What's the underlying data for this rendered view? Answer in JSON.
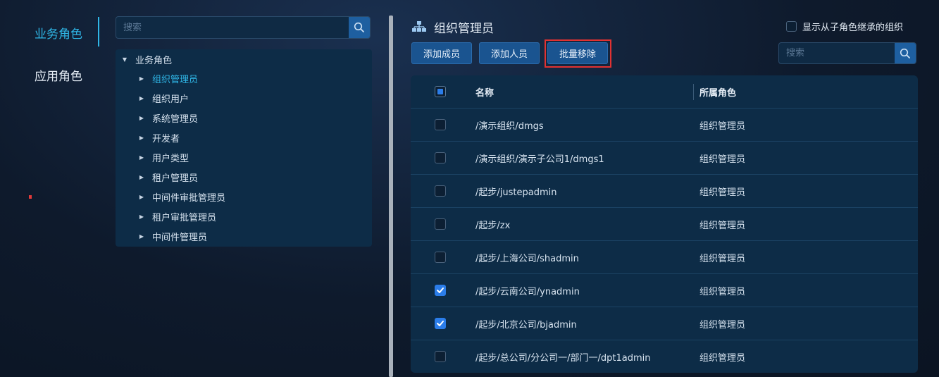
{
  "left_tabs": [
    {
      "label": "业务角色",
      "active": true
    },
    {
      "label": "应用角色",
      "active": false
    }
  ],
  "tree": {
    "search_placeholder": "搜索",
    "root": {
      "label": "业务角色",
      "expanded": true
    },
    "items": [
      {
        "label": "组织管理员",
        "selected": true
      },
      {
        "label": "组织用户",
        "selected": false
      },
      {
        "label": "系统管理员",
        "selected": false
      },
      {
        "label": "开发者",
        "selected": false
      },
      {
        "label": "用户类型",
        "selected": false
      },
      {
        "label": "租户管理员",
        "selected": false
      },
      {
        "label": "中间件审批管理员",
        "selected": false
      },
      {
        "label": "租户审批管理员",
        "selected": false
      },
      {
        "label": "中间件管理员",
        "selected": false
      }
    ]
  },
  "panel": {
    "title": "组织管理员",
    "inherit_option_label": "显示从子角色继承的组织",
    "inherit_checked": false,
    "buttons": {
      "add_member": "添加成员",
      "add_person": "添加人员",
      "batch_remove": "批量移除"
    },
    "search_placeholder": "搜索"
  },
  "table": {
    "columns": {
      "name": "名称",
      "role": "所属角色"
    },
    "header_partial_selected": true,
    "rows": [
      {
        "name": "/演示组织/dmgs",
        "role": "组织管理员",
        "checked": false
      },
      {
        "name": "/演示组织/演示子公司1/dmgs1",
        "role": "组织管理员",
        "checked": false
      },
      {
        "name": "/起步/justepadmin",
        "role": "组织管理员",
        "checked": false
      },
      {
        "name": "/起步/zx",
        "role": "组织管理员",
        "checked": false
      },
      {
        "name": "/起步/上海公司/shadmin",
        "role": "组织管理员",
        "checked": false
      },
      {
        "name": "/起步/云南公司/ynadmin",
        "role": "组织管理员",
        "checked": true
      },
      {
        "name": "/起步/北京公司/bjadmin",
        "role": "组织管理员",
        "checked": true
      },
      {
        "name": "/起步/总公司/分公司一/部门一/dpt1admin",
        "role": "组织管理员",
        "checked": false
      }
    ]
  },
  "colors": {
    "accent": "#2fb6e6",
    "button": "#1a5490",
    "checkbox_checked": "#2b7de9",
    "highlight_border": "#e23232"
  }
}
